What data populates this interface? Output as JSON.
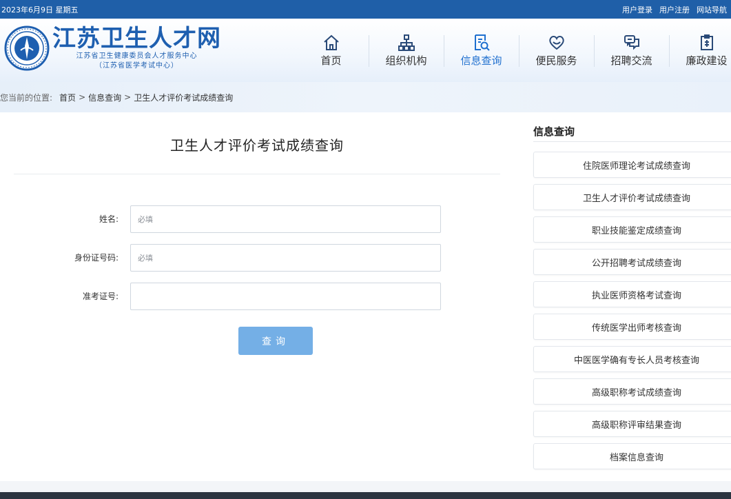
{
  "topbar": {
    "date": "2023年6月9日 星期五",
    "links": [
      "用户登录",
      "用户注册",
      "网站导航"
    ]
  },
  "header": {
    "site_title": "江苏卫生人才网",
    "subtitle_line1": "江苏省卫生健康委员会人才服务中心",
    "subtitle_line2": "（江苏省医学考试中心）",
    "nav": [
      {
        "label": "首页",
        "icon": "home-icon"
      },
      {
        "label": "组织机构",
        "icon": "org-chart-icon"
      },
      {
        "label": "信息查询",
        "icon": "search-document-icon"
      },
      {
        "label": "便民服务",
        "icon": "heart-service-icon"
      },
      {
        "label": "招聘交流",
        "icon": "chat-bubbles-icon"
      },
      {
        "label": "廉政建设",
        "icon": "shield-document-icon"
      }
    ],
    "active_nav": "信息查询"
  },
  "breadcrumb": {
    "prefix": "您当前的位置:",
    "items": [
      "首页",
      "信息查询",
      "卫生人才评价考试成绩查询"
    ],
    "separator": ">"
  },
  "form": {
    "title": "卫生人才评价考试成绩查询",
    "fields": [
      {
        "label": "姓名:",
        "placeholder": "必填",
        "value": ""
      },
      {
        "label": "身份证号码:",
        "placeholder": "必填",
        "value": ""
      },
      {
        "label": "准考证号:",
        "placeholder": "",
        "value": ""
      }
    ],
    "submit_label": "查询"
  },
  "sidebar": {
    "title": "信息查询",
    "items": [
      "住院医师理论考试成绩查询",
      "卫生人才评价考试成绩查询",
      "职业技能鉴定成绩查询",
      "公开招聘考试成绩查询",
      "执业医师资格考试查询",
      "传统医学出师考核查询",
      "中医医学确有专长人员考核查询",
      "高级职称考试成绩查询",
      "高级职称评审结果查询",
      "档案信息查询"
    ]
  },
  "colors": {
    "topbar": "#1f5fa8",
    "brand_blue": "#1e5fb0",
    "active_nav": "#1e6fcf",
    "button": "#74afe6"
  }
}
